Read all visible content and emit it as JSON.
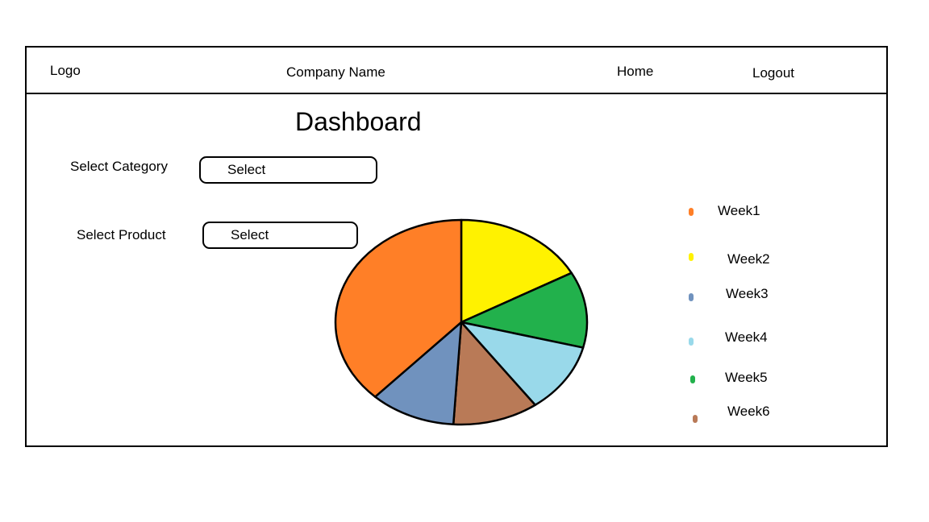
{
  "header": {
    "logo": "Logo",
    "company_name": "Company Name",
    "nav_home": "Home",
    "nav_logout": "Logout"
  },
  "page": {
    "title": "Dashboard"
  },
  "filters": {
    "category_label": "Select Category",
    "category_value": "Select",
    "product_label": "Select Product",
    "product_value": "Select"
  },
  "chart_data": {
    "type": "pie",
    "categories": [
      "Week1",
      "Week2",
      "Week3",
      "Week4",
      "Week5",
      "Week6"
    ],
    "values": [
      17,
      12,
      11,
      11,
      11,
      38
    ],
    "colors": [
      "#FFF200",
      "#22B14C",
      "#99D9EA",
      "#B97A57",
      "#7092BE",
      "#FF7F27"
    ],
    "legend": [
      {
        "label": "Week1",
        "color": "#FF7F27"
      },
      {
        "label": "Week2",
        "color": "#FFF200"
      },
      {
        "label": "Week3",
        "color": "#7092BE"
      },
      {
        "label": "Week4",
        "color": "#99D9EA"
      },
      {
        "label": "Week5",
        "color": "#22B14C"
      },
      {
        "label": "Week6",
        "color": "#B97A57"
      }
    ],
    "legend_placement": "right"
  }
}
